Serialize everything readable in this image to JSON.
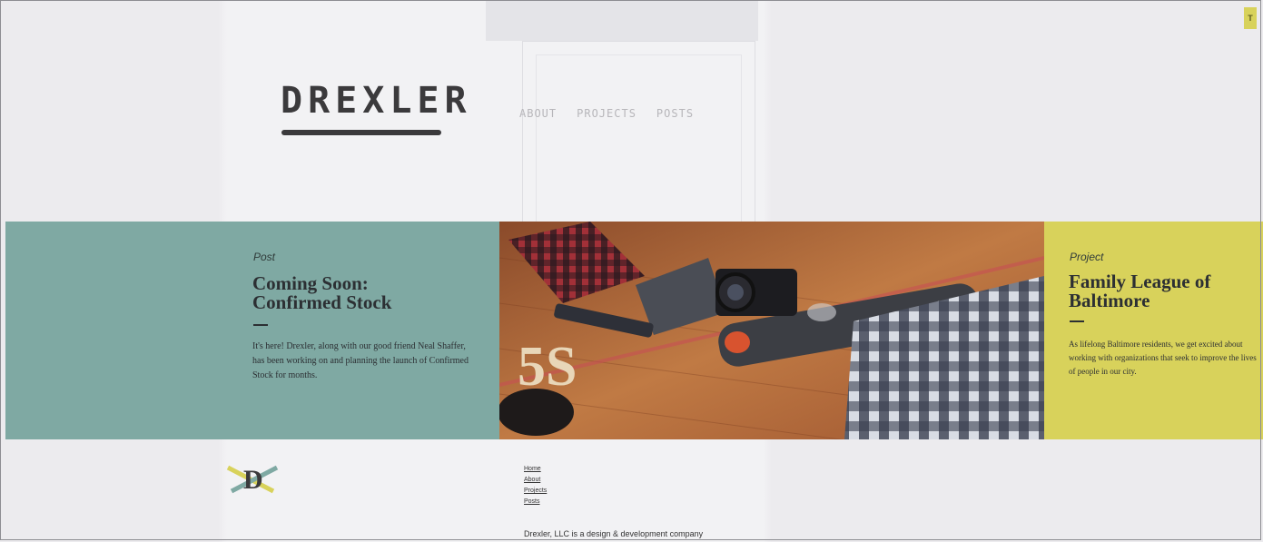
{
  "site": {
    "logo": "DREXLER"
  },
  "nav": {
    "items": [
      "ABOUT",
      "PROJECTS",
      "POSTS"
    ]
  },
  "features": {
    "post": {
      "kicker": "Post",
      "title_line1": "Coming Soon:",
      "title_line2": "Confirmed Stock",
      "excerpt": "It's here! Drexler, along with our good friend Neal Shaffer, has been working on and planning the launch of Confirmed Stock for months."
    },
    "project": {
      "kicker": "Project",
      "title_line1": "Family League of",
      "title_line2": "Baltimore",
      "excerpt": "As lifelong Baltimore residents, we get excited about working with organizations that seek to improve the lives of people in our city."
    }
  },
  "badge": "T",
  "footer": {
    "logo_letter": "D",
    "links": [
      "Home",
      "About",
      "Projects",
      "Posts"
    ],
    "tagline": "Drexler, LLC is a design & development company"
  },
  "colors": {
    "teal": "#7fa9a3",
    "yellow": "#d8d25b",
    "ink": "#3b3a3c"
  }
}
